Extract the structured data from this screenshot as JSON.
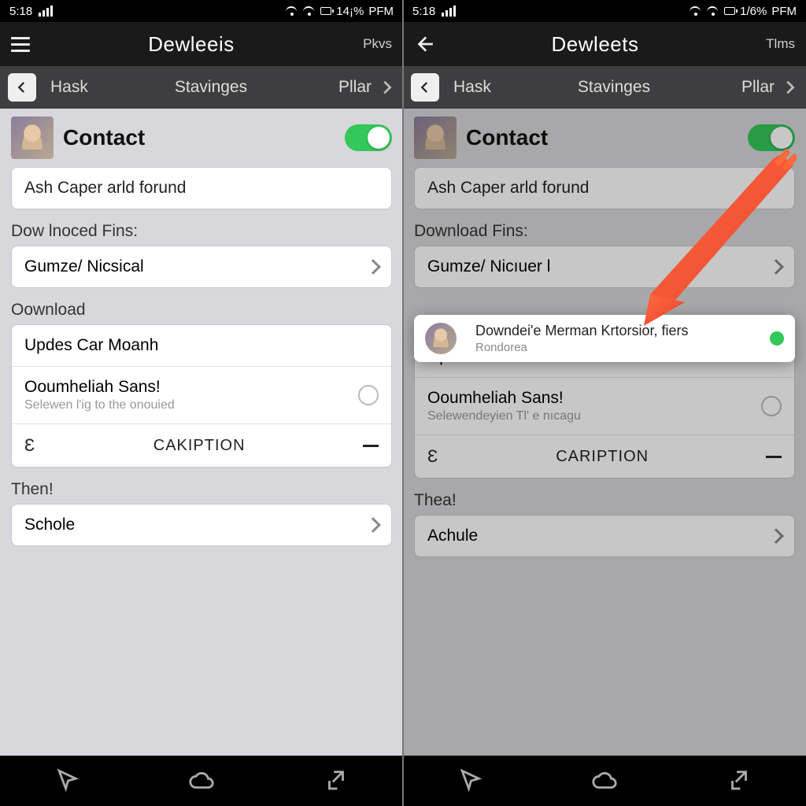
{
  "left": {
    "status": {
      "time": "5:18",
      "pct": "14¡%",
      "suffix": "PFM"
    },
    "header": {
      "title": "Dewleeis",
      "right": "Pkvs"
    },
    "subnav": {
      "a": "Hask",
      "b": "Stavinges",
      "c": "Pllar"
    },
    "contact": {
      "title": "Contact"
    },
    "field1": "Ash Caper arld forund",
    "label1": "Dow lnoced  Fins:",
    "select1": "Gumze/ Nicsical",
    "label2": "Oownload",
    "row1": "Updes Car Moanh",
    "row2": {
      "title": "Ooumheliah Sans!",
      "sub": "Selewen l'ig to the onouied"
    },
    "caption": "CAKIPTION",
    "eglyph": "Ɛ",
    "label3": "Then!",
    "row3": "Schole"
  },
  "right": {
    "status": {
      "time": "5:18",
      "pct": "1/6%",
      "suffix": "PFM"
    },
    "header": {
      "title": "Dewleets",
      "right": "Tlms"
    },
    "subnav": {
      "a": "Hask",
      "b": "Stavinges",
      "c": "Pllar"
    },
    "contact": {
      "title": "Contact"
    },
    "field1": "Ash Caper arld forund",
    "label1": "Download  Fins:",
    "select1": "Gumze/ Nicıuer l",
    "popup": {
      "title": "Downdei'e Merman Krtorsior, fiers",
      "sub": "Rondorea"
    },
    "row1": "Updes Sor Heaich",
    "row2": {
      "title": "Ooumheliah Sans!",
      "sub": "Selewendeyien  Tl' e nıcagu"
    },
    "caption": "CARIPTION",
    "eglyph": "Ɛ",
    "label3": "Thea!",
    "row3": "Achule"
  }
}
